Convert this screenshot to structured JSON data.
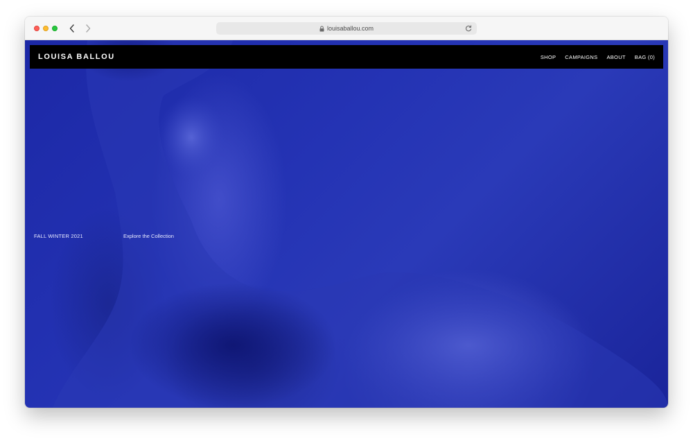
{
  "browser": {
    "url": "louisaballou.com",
    "icons": [
      "close-icon",
      "minimize-icon",
      "maximize-icon",
      "chevron-left-icon",
      "chevron-right-icon",
      "lock-icon",
      "reload-icon"
    ]
  },
  "site": {
    "logo": "LOUISA BALLOU",
    "nav": {
      "shop": "SHOP",
      "campaigns": "CAMPAIGNS",
      "about": "ABOUT",
      "bag": "BAG (0)"
    }
  },
  "hero": {
    "season": "FALL WINTER 2021",
    "cta": "Explore the Collection",
    "background_color": "#2332b0"
  }
}
